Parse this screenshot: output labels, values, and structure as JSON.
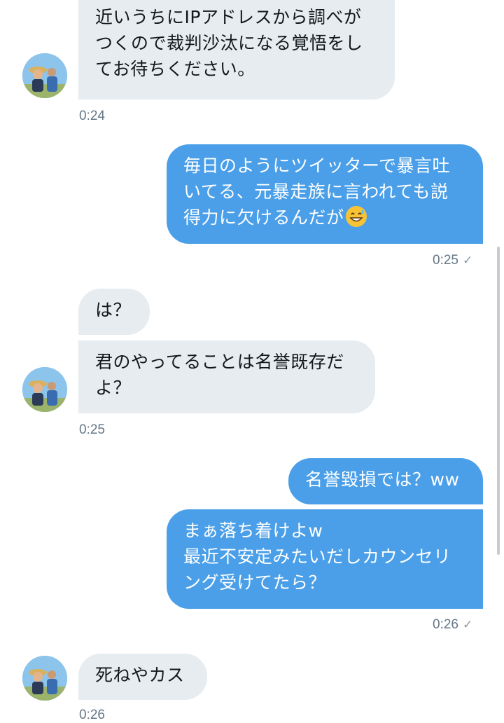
{
  "messages": [
    {
      "dir": "in",
      "lines": [
        "近いうちにIPアドレスから調べが",
        "つくので裁判沙汰になる覚悟をし",
        "てお待ちください。"
      ],
      "time": "0:24"
    },
    {
      "dir": "out",
      "lines": [
        "毎日のようにツイッターで暴言吐",
        "いてる、元暴走族に言われても説",
        "得力に欠けるんだが"
      ],
      "emoji": "grinning-sweat-emoji",
      "time": "0:25",
      "status": "✓"
    },
    {
      "dir": "in",
      "lines": [
        "は？"
      ]
    },
    {
      "dir": "in",
      "lines": [
        "君のやってることは名誉既存だ",
        "よ？"
      ],
      "time": "0:25"
    },
    {
      "dir": "out",
      "lines": [
        "名誉毀損では？ww"
      ]
    },
    {
      "dir": "out",
      "lines": [
        "まぁ落ち着けよw",
        "最近不安定みたいだしカウンセリ",
        "ング受けてたら？"
      ],
      "time": "0:26",
      "status": "✓"
    },
    {
      "dir": "in",
      "lines": [
        "死ねやカス"
      ],
      "time": "0:26"
    }
  ]
}
